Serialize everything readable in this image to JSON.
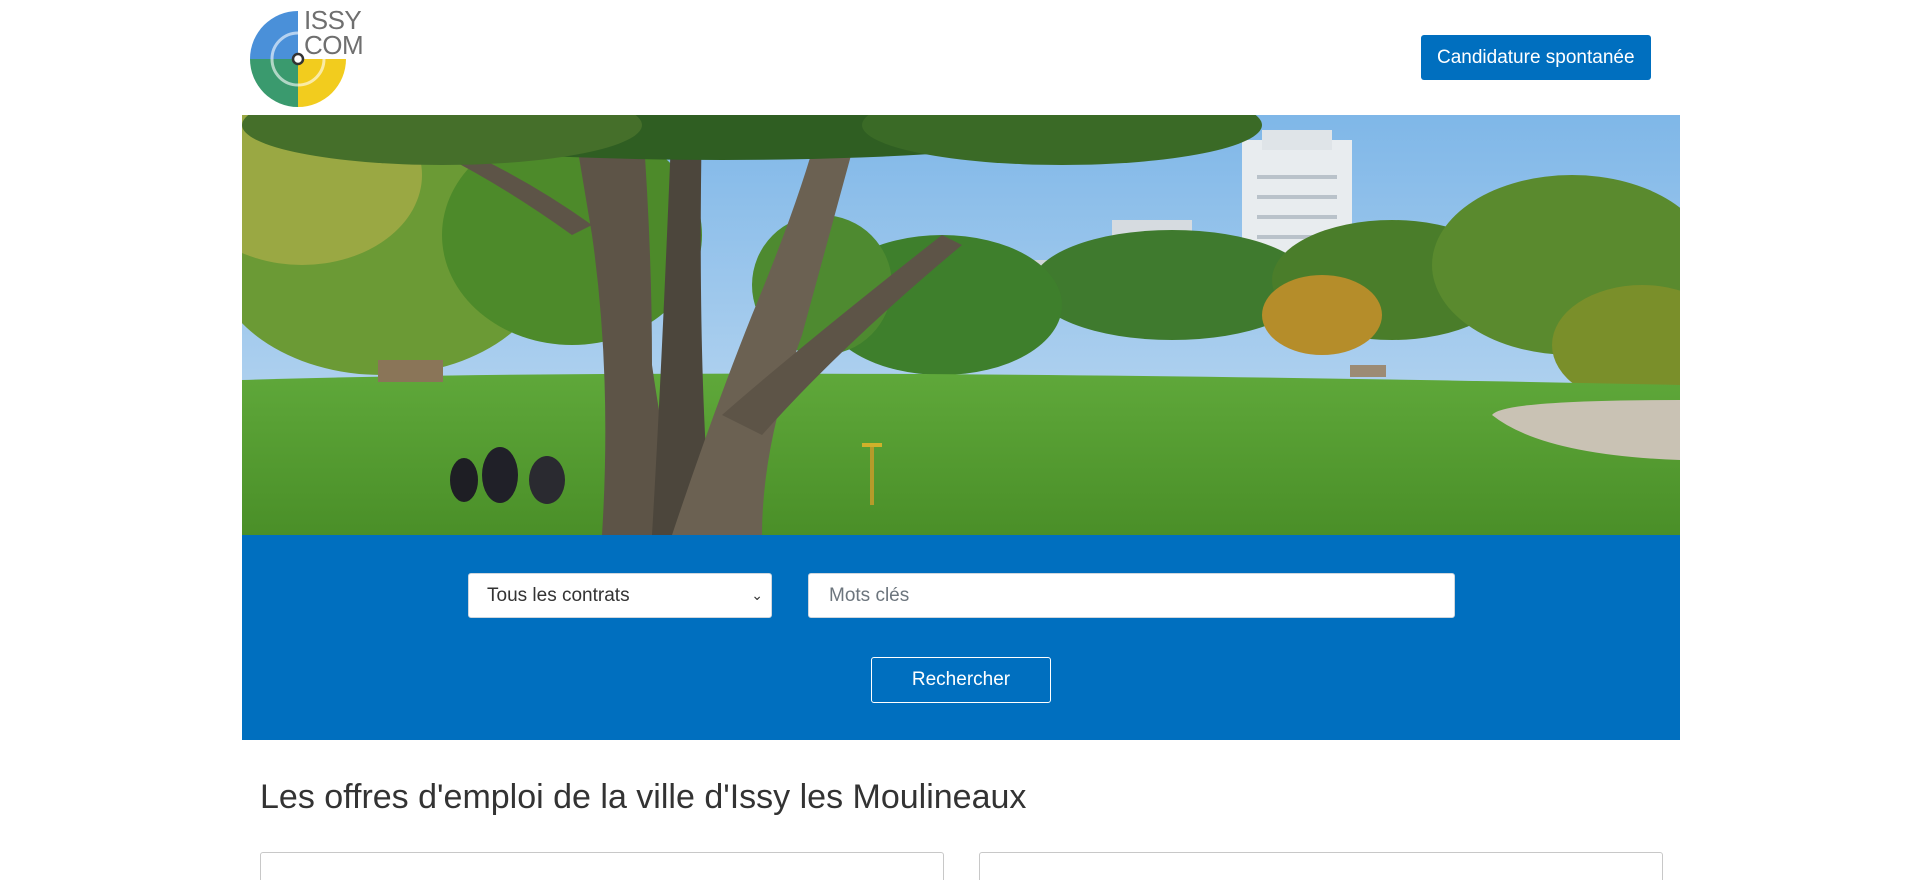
{
  "header": {
    "logo_text_line1": "ISSY",
    "logo_text_line2": "COM",
    "cta_label": "Candidature spontanée"
  },
  "search": {
    "contract_select_value": "Tous les contrats",
    "keywords_placeholder": "Mots clés",
    "keywords_value": "",
    "submit_label": "Rechercher"
  },
  "main": {
    "title": "Les offres d'emploi de la ville d'Issy les Moulineaux"
  },
  "colors": {
    "brand_blue": "#006fbf",
    "logo_blue": "#4a90d9",
    "logo_green": "#3a9a6e",
    "logo_yellow": "#f2cc1e"
  },
  "icons": {
    "select_chevron": "chevron-down-icon"
  }
}
